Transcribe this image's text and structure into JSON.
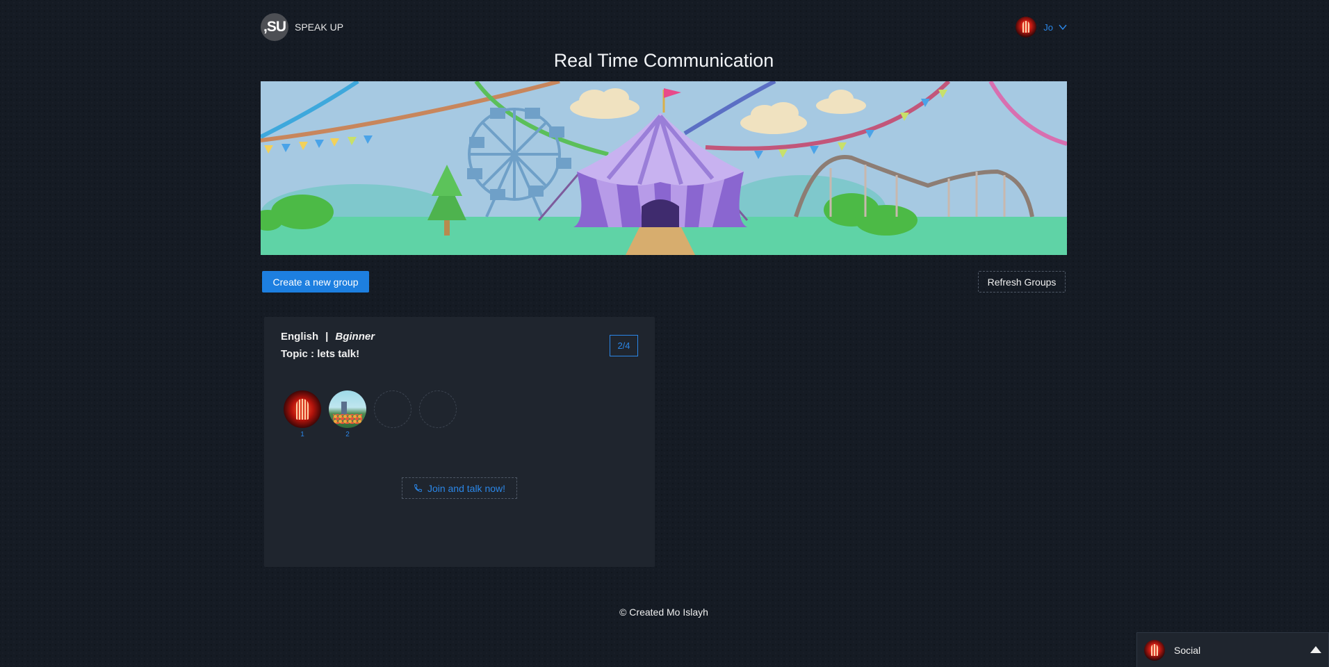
{
  "brand": {
    "badge": ",SU",
    "name": "SPEAK UP"
  },
  "user": {
    "name": "Jo"
  },
  "page": {
    "title": "Real Time Communication"
  },
  "actions": {
    "create_label": "Create a new group",
    "refresh_label": "Refresh Groups"
  },
  "groups": [
    {
      "language": "English",
      "separator": "|",
      "level": "Bginner",
      "topic": "Topic : lets talk!",
      "count": "2/4",
      "slots": [
        {
          "num": "1",
          "filled": true
        },
        {
          "num": "2",
          "filled": true
        },
        {
          "num": "",
          "filled": false
        },
        {
          "num": "",
          "filled": false
        }
      ],
      "join_label": "Join and talk now!"
    }
  ],
  "footer": {
    "text": "© Created Mo Islayh"
  },
  "social": {
    "label": "Social"
  },
  "colors": {
    "accent": "#1d7fe0",
    "link": "#2b87e8",
    "background": "#151b24",
    "card": "#1f252e"
  }
}
